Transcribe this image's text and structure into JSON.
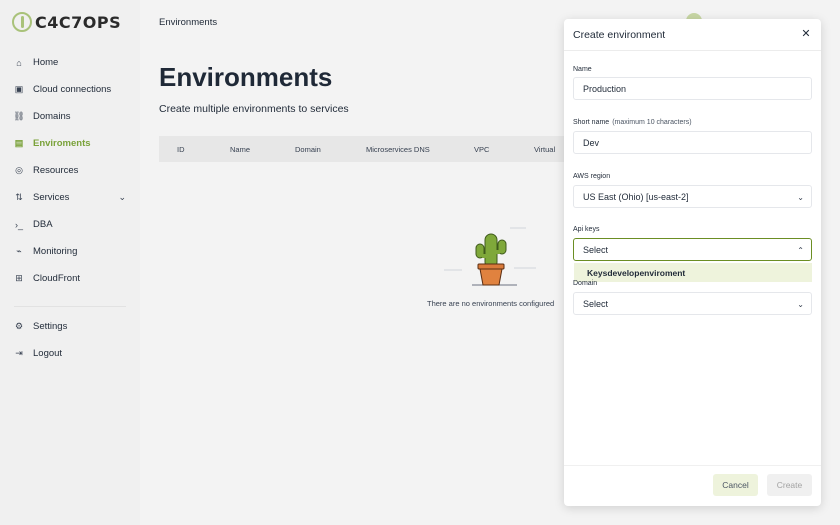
{
  "logo": {
    "text": "C4C7OPS"
  },
  "sidebar": {
    "items": [
      {
        "label": "Home",
        "icon": "home-icon",
        "glyph": "⌂"
      },
      {
        "label": "Cloud connections",
        "icon": "cloud-icon",
        "glyph": "▣"
      },
      {
        "label": "Domains",
        "icon": "link-icon",
        "glyph": "⛓"
      },
      {
        "label": "Enviroments",
        "icon": "layers-icon",
        "glyph": "▤"
      },
      {
        "label": "Resources",
        "icon": "database-icon",
        "glyph": "◎"
      },
      {
        "label": "Services",
        "icon": "services-icon",
        "glyph": "⇅"
      },
      {
        "label": "DBA",
        "icon": "terminal-icon",
        "glyph": "›_"
      },
      {
        "label": "Monitoring",
        "icon": "chart-icon",
        "glyph": "⌁"
      },
      {
        "label": "CloudFront",
        "icon": "grid-icon",
        "glyph": "⊞"
      }
    ],
    "bottom_items": [
      {
        "label": "Settings",
        "icon": "gear-icon",
        "glyph": "⚙"
      },
      {
        "label": "Logout",
        "icon": "logout-icon",
        "glyph": "⇥"
      }
    ],
    "active_index": 3,
    "accent": "#7aa23a"
  },
  "header": {
    "title": "Environments"
  },
  "main": {
    "title": "Environments",
    "subtitle": "Create multiple environments to services",
    "table": {
      "columns": [
        "ID",
        "Name",
        "Domain",
        "Microservices DNS",
        "VPC",
        "Virtual"
      ]
    },
    "empty_text": "There are no environments configured"
  },
  "modal": {
    "title": "Create environment",
    "fields": {
      "name": {
        "label": "Name",
        "value": "Production"
      },
      "short_name": {
        "label": "Short name",
        "hint": "(maximum 10 characters)",
        "value": "Dev"
      },
      "aws_region": {
        "label": "AWS region",
        "value": "US East (Ohio) [us-east-2]"
      },
      "api_keys": {
        "label": "Api keys",
        "value": "Select"
      },
      "domain": {
        "label": "Domain",
        "value": "Select"
      }
    },
    "dropdown": {
      "options": [
        "Keysdevelopenviroment"
      ]
    },
    "cancel_label": "Cancel",
    "create_label": "Create"
  }
}
